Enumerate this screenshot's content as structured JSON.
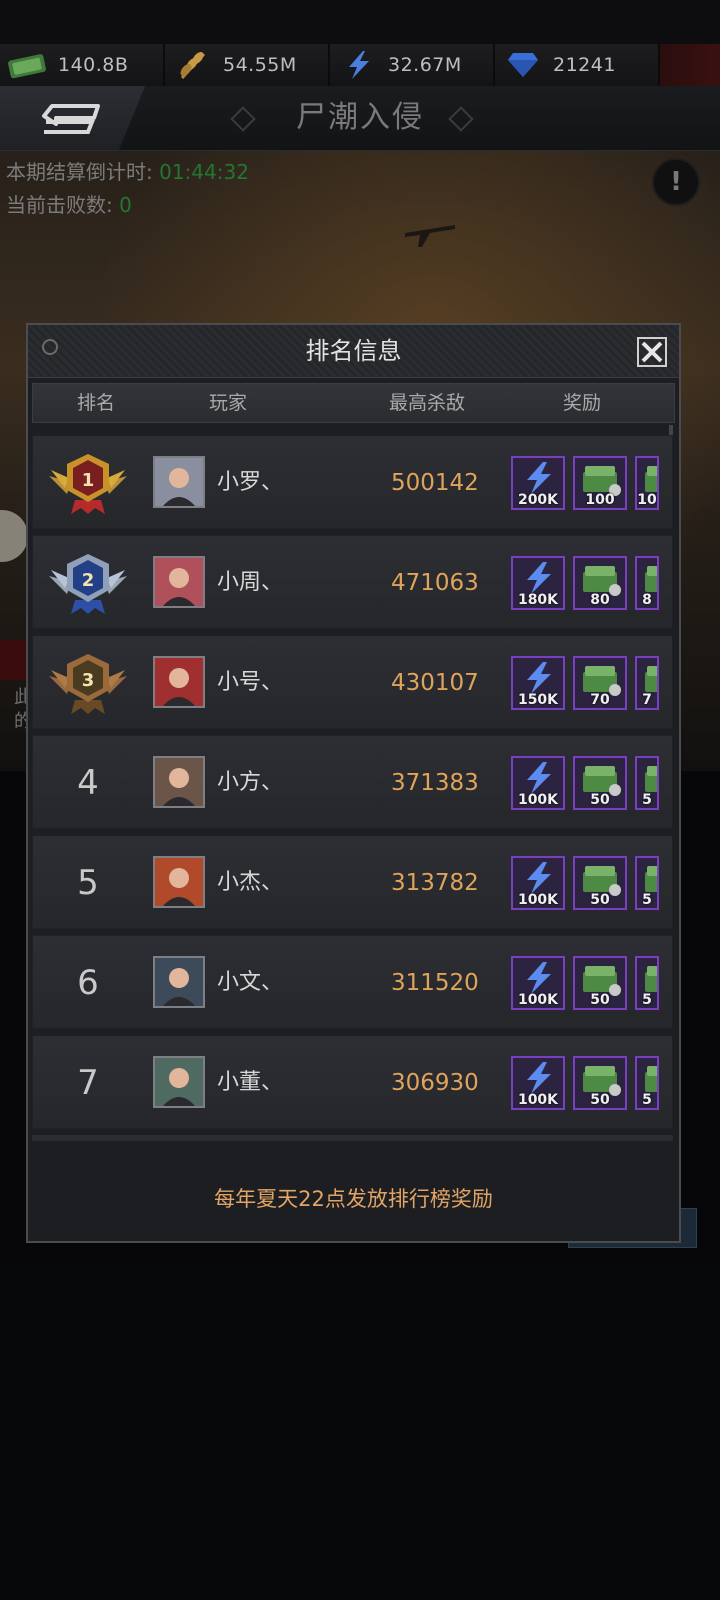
{
  "resources": [
    {
      "name": "cash",
      "icon": "cash-icon",
      "value": "140.8B"
    },
    {
      "name": "wheat",
      "icon": "wheat-icon",
      "value": "54.55M"
    },
    {
      "name": "energy",
      "icon": "lightning-icon",
      "value": "32.67M"
    },
    {
      "name": "diamond",
      "icon": "diamond-icon",
      "value": "21241"
    }
  ],
  "header": {
    "title": "尸潮入侵"
  },
  "event": {
    "countdown_label": "本期结算倒计时:",
    "countdown_value": "01:44:32",
    "defeated_label": "当前击败数:",
    "defeated_value": "0"
  },
  "background_cut_text": {
    "line1": "此",
    "line2": "的"
  },
  "modal": {
    "title": "排名信息",
    "columns": {
      "rank": "排名",
      "player": "玩家",
      "kills": "最高杀敌",
      "reward": "奖励"
    },
    "footer": "每年夏天22点发放排行榜奖励"
  },
  "rankings": [
    {
      "rank": "1",
      "medal": "gold",
      "name": "小罗、",
      "kills": "500142",
      "rewards": [
        "200K",
        "100",
        "10"
      ]
    },
    {
      "rank": "2",
      "medal": "silver",
      "name": "小周、",
      "kills": "471063",
      "rewards": [
        "180K",
        "80",
        "8"
      ]
    },
    {
      "rank": "3",
      "medal": "bronze",
      "name": "小号、",
      "kills": "430107",
      "rewards": [
        "150K",
        "70",
        "7"
      ]
    },
    {
      "rank": "4",
      "medal": "",
      "name": "小方、",
      "kills": "371383",
      "rewards": [
        "100K",
        "50",
        "5"
      ]
    },
    {
      "rank": "5",
      "medal": "",
      "name": "小杰、",
      "kills": "313782",
      "rewards": [
        "100K",
        "50",
        "5"
      ]
    },
    {
      "rank": "6",
      "medal": "",
      "name": "小文、",
      "kills": "311520",
      "rewards": [
        "100K",
        "50",
        "5"
      ]
    },
    {
      "rank": "7",
      "medal": "",
      "name": "小董、",
      "kills": "306930",
      "rewards": [
        "100K",
        "50",
        "5"
      ]
    }
  ],
  "colors": {
    "kills": "#e0a35a",
    "countdown": "#39b44a",
    "reward_border": "#7a3fc0",
    "footer": "#e2a466"
  }
}
